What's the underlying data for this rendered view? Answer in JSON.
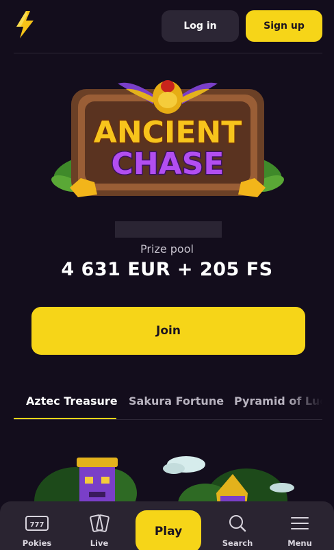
{
  "header": {
    "login_label": "Log in",
    "signup_label": "Sign up"
  },
  "promo": {
    "title_line1": "ANCIENT",
    "title_line2": "CHASE",
    "prize_label": "Prize pool",
    "prize_value": "4 631 EUR + 205 FS",
    "join_label": "Join"
  },
  "tabs": [
    {
      "label": "Aztec Treasure",
      "active": true
    },
    {
      "label": "Sakura Fortune",
      "active": false
    },
    {
      "label": "Pyramid of Luck",
      "active": false
    }
  ],
  "bottom_nav": {
    "items": [
      {
        "label": "Pokies",
        "icon": "slot-machine-icon",
        "icon_text": "777"
      },
      {
        "label": "Live",
        "icon": "cards-icon"
      },
      {
        "label": "Search",
        "icon": "search-icon"
      },
      {
        "label": "Menu",
        "icon": "menu-icon"
      }
    ],
    "play_label": "Play"
  },
  "colors": {
    "background": "#130d1c",
    "accent": "#f6d518",
    "button_dark": "#2c2635",
    "nav_bg": "#2a2431"
  }
}
